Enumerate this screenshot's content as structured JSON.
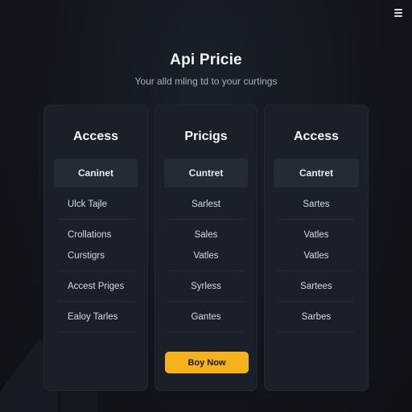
{
  "header": {
    "title": "Api Pricie",
    "subtitle": "Your alld mling td to your curtings"
  },
  "columns": [
    {
      "heading": "Access",
      "subheading": "Caninet",
      "rows": [
        "Ulck Tajle",
        "Crollations",
        "Curstigrs",
        "Accest Priges",
        "Ealoy Tarles"
      ]
    },
    {
      "heading": "Pricigs",
      "subheading": "Cuntret",
      "rows": [
        "Sarlest",
        "Sales",
        "Vatles",
        "Syrless",
        "Gantes"
      ],
      "button_label": "Boy Now"
    },
    {
      "heading": "Access",
      "subheading": "Cantret",
      "rows": [
        "Sartes",
        "Vatles",
        "Vatles",
        "Sartees",
        "Sarbes"
      ]
    }
  ],
  "icons": {
    "menu": "hamburger-menu-icon"
  },
  "colors": {
    "background": "#12161c",
    "card": "#1b2028",
    "accent": "#f5b21c"
  }
}
